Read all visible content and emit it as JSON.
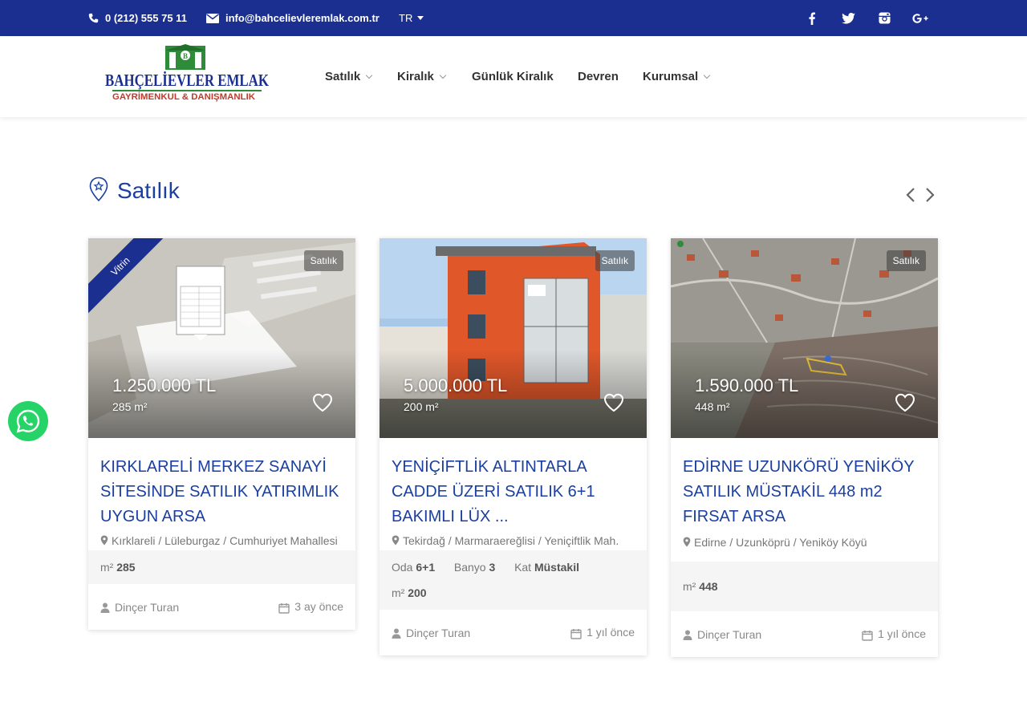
{
  "topbar": {
    "phone": "0 (212) 555 75 11",
    "email": "info@bahcelievleremlak.com.tr",
    "language": "TR",
    "social_icons": [
      "facebook-icon",
      "twitter-icon",
      "instagram-icon",
      "google-plus-icon"
    ]
  },
  "logo": {
    "line1": "BAHÇELİEVLER EMLAK",
    "line2": "GAYRİMENKUL & DANIŞMANLIK"
  },
  "nav": {
    "items": [
      {
        "label": "Satılık",
        "has_dropdown": true
      },
      {
        "label": "Kiralık",
        "has_dropdown": true
      },
      {
        "label": "Günlük Kiralık",
        "has_dropdown": false
      },
      {
        "label": "Devren",
        "has_dropdown": false
      },
      {
        "label": "Kurumsal",
        "has_dropdown": true
      }
    ]
  },
  "section": {
    "title": "Satılık"
  },
  "listings": [
    {
      "badge": "Satılık",
      "ribbon": "Vitrin",
      "price": "1.250.000 TL",
      "area": "285 m²",
      "title": "KIRKLARELİ MERKEZ SANAYİ SİTESİNDE SATILIK YATIRIMLIK UYGUN ARSA",
      "location": "Kırklareli / Lüleburgaz / Cumhuriyet Mahallesi",
      "m2_label": "m²",
      "m2_value": "285",
      "agent": "Dinçer Turan",
      "time": "3 ay önce"
    },
    {
      "badge": "Satılık",
      "price": "5.000.000 TL",
      "area": "200 m²",
      "title": "YENİÇİFTLİK ALTINTARLA CADDE ÜZERİ SATILIK 6+1 BAKIMLI LÜX ...",
      "location": "Tekirdağ / Marmaraereğlisi / Yeniçiftlik Mah.",
      "oda_label": "Oda",
      "oda_value": "6+1",
      "banyo_label": "Banyo",
      "banyo_value": "3",
      "kat_label": "Kat",
      "kat_value": "Müstakil",
      "m2_label": "m²",
      "m2_value": "200",
      "agent": "Dinçer Turan",
      "time": "1 yıl önce"
    },
    {
      "badge": "Satılık",
      "price": "1.590.000 TL",
      "area": "448 m²",
      "title": "EDİRNE UZUNKÖRÜ YENİKÖY SATILIK MÜSTAKİL 448 m2 FIRSAT ARSA",
      "location": "Edirne / Uzunköprü / Yeniköy Köyü",
      "m2_label": "m²",
      "m2_value": "448",
      "agent": "Dinçer Turan",
      "time": "1 yıl önce"
    }
  ]
}
